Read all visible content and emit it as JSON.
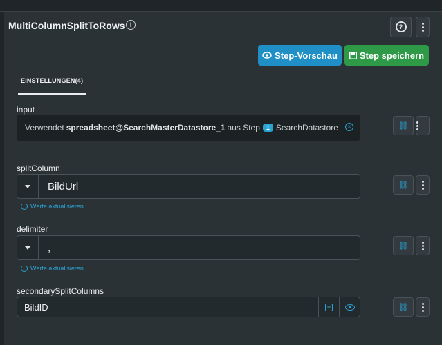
{
  "header": {
    "title": "MultiColumnSplitToRows"
  },
  "actions": {
    "preview_label": "Step-Vorschau",
    "save_label": "Step speichern"
  },
  "tabs": [
    {
      "label": "EINSTELLUNGEN(4)"
    }
  ],
  "fields": {
    "input": {
      "label": "input",
      "prefix": "Verwendet",
      "source": "spreadsheet@SearchMasterDatastore_1",
      "mid": "aus Step",
      "step_number": "1",
      "step_name": "SearchDatastore"
    },
    "splitColumn": {
      "label": "splitColumn",
      "value": "BildUrl",
      "refresh": "Werte aktualisieren"
    },
    "delimiter": {
      "label": "delimiter",
      "value": ",",
      "refresh": "Werte aktualisieren"
    },
    "secondarySplitColumns": {
      "label": "secondarySplitColumns",
      "value": "BildID"
    }
  },
  "icons": {
    "info": "info-icon",
    "help": "help-icon",
    "more": "kebab-icon",
    "eye": "eye-icon",
    "save": "floppy-icon",
    "link": "link-icon",
    "clear": "clear-icon",
    "refresh": "refresh-icon",
    "add": "add-icon"
  },
  "colors": {
    "primary": "#1f8fc6",
    "success": "#2e9a48",
    "accent": "#2aa3d3",
    "background": "#2b3236"
  }
}
